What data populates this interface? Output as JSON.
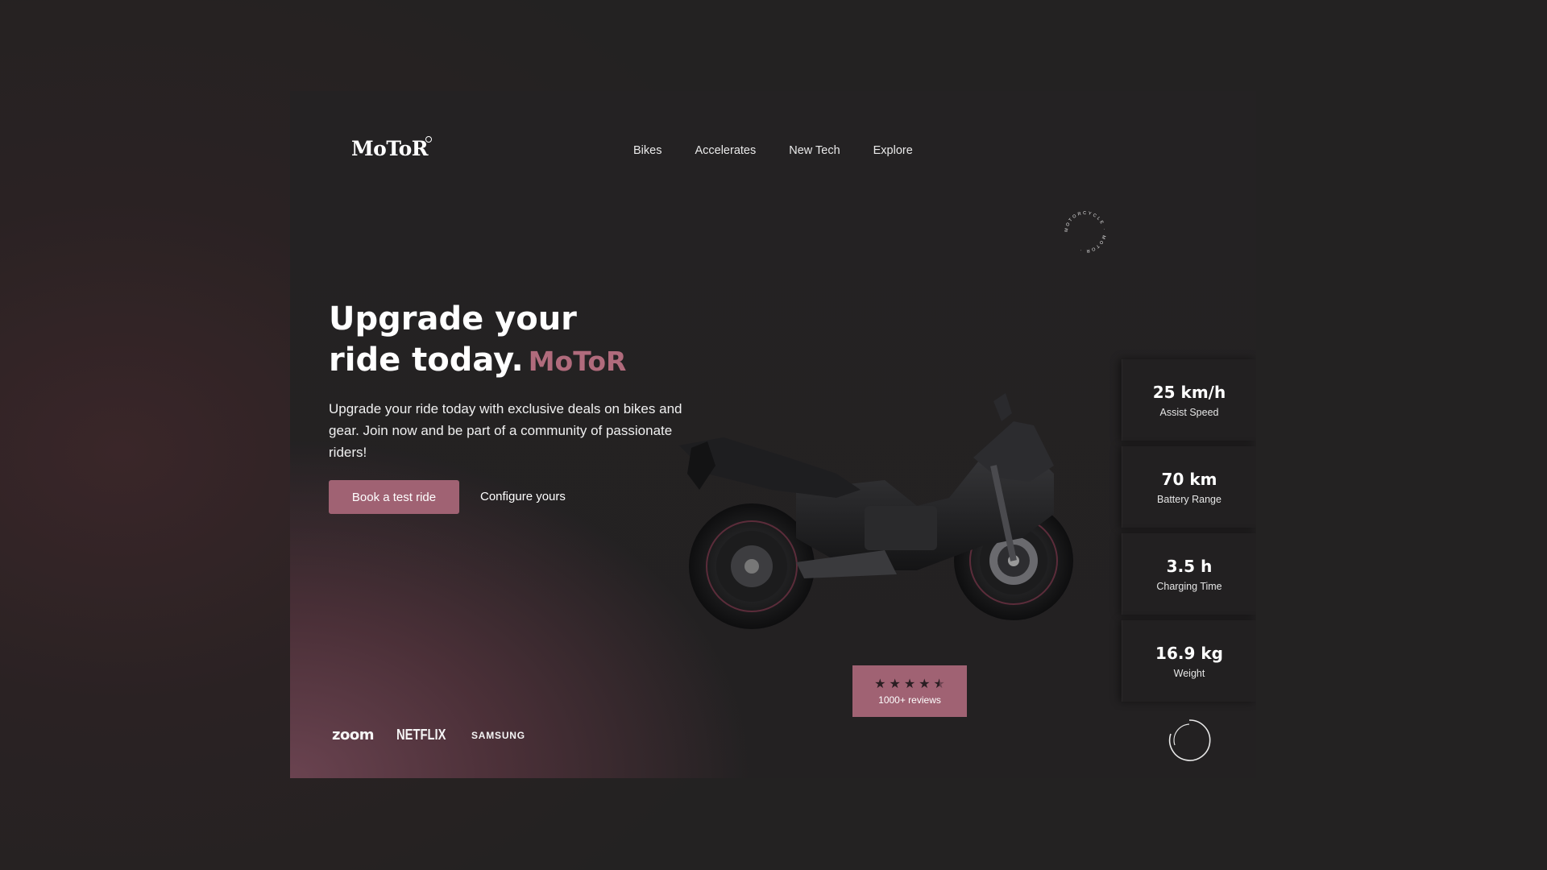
{
  "brand": {
    "logo": "MoToR"
  },
  "nav": {
    "items": [
      {
        "label": "Bikes"
      },
      {
        "label": "Accelerates"
      },
      {
        "label": "New Tech"
      },
      {
        "label": "Explore"
      }
    ]
  },
  "circle_badge": {
    "text": "MOTORCYCLE · MOTOR · "
  },
  "hero": {
    "title_line1": "Upgrade your",
    "title_line2": "ride today.",
    "title_brand": "MoToR",
    "description": "Upgrade your ride today with exclusive deals on bikes and gear. Join now and be part of a community of passionate riders!",
    "primary_cta": "Book a test ride",
    "secondary_cta": "Configure yours"
  },
  "stats": [
    {
      "value": "25 km/h",
      "label": "Assist Speed"
    },
    {
      "value": "70 km",
      "label": "Battery Range"
    },
    {
      "value": "3.5 h",
      "label": "Charging Time"
    },
    {
      "value": "16.9 kg",
      "label": "Weight"
    }
  ],
  "reviews": {
    "rating": 4.5,
    "max": 5,
    "text": "1000+ reviews"
  },
  "partners": {
    "zoom": "zoom",
    "netflix": "NETFLIX",
    "samsung": "SAMSUNG"
  },
  "colors": {
    "accent": "#a06273",
    "brand_text": "#b06b7c",
    "background": "#232222"
  },
  "icons": {
    "star": "star-icon",
    "spinner": "loading-spinner-icon",
    "bike": "motorcycle-image"
  }
}
